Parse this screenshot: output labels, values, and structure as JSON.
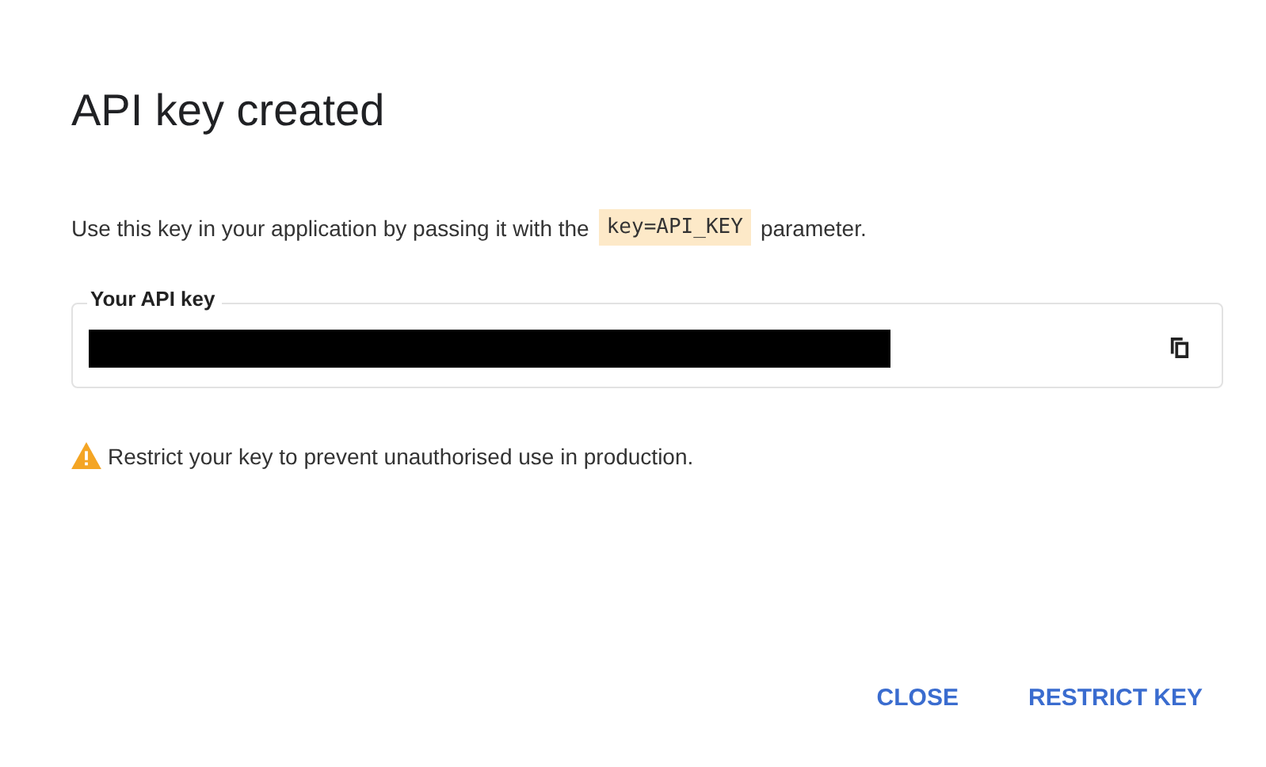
{
  "dialog": {
    "title": "API key created",
    "instruction": {
      "before": "Use this key in your application by passing it with the",
      "code": "key=API_KEY",
      "after": "parameter."
    },
    "key_field": {
      "label": "Your API key",
      "redacted": true
    },
    "warning": "Restrict your key to prevent unauthorised use in production.",
    "buttons": [
      {
        "label": "CLOSE"
      },
      {
        "label": "RESTRICT KEY"
      }
    ]
  }
}
